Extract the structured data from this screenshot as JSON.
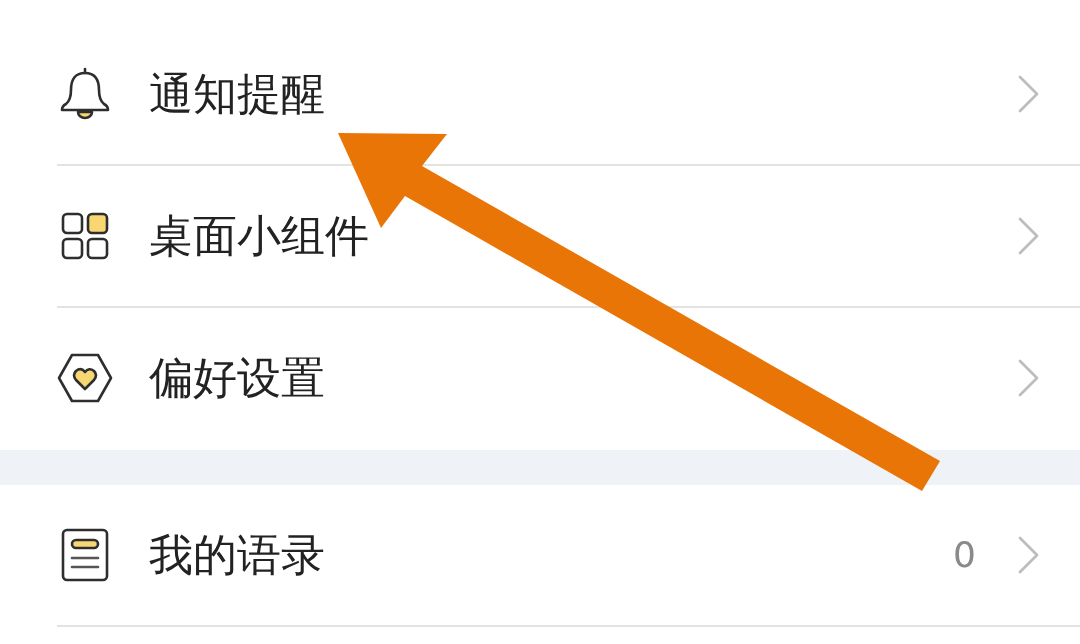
{
  "sections": [
    {
      "items": [
        {
          "kind": "bell",
          "label": "通知提醒"
        },
        {
          "kind": "grid",
          "label": "桌面小组件"
        },
        {
          "kind": "hexagon",
          "label": "偏好设置"
        }
      ]
    },
    {
      "items": [
        {
          "kind": "note",
          "label": "我的语录",
          "value": "0"
        }
      ]
    }
  ]
}
